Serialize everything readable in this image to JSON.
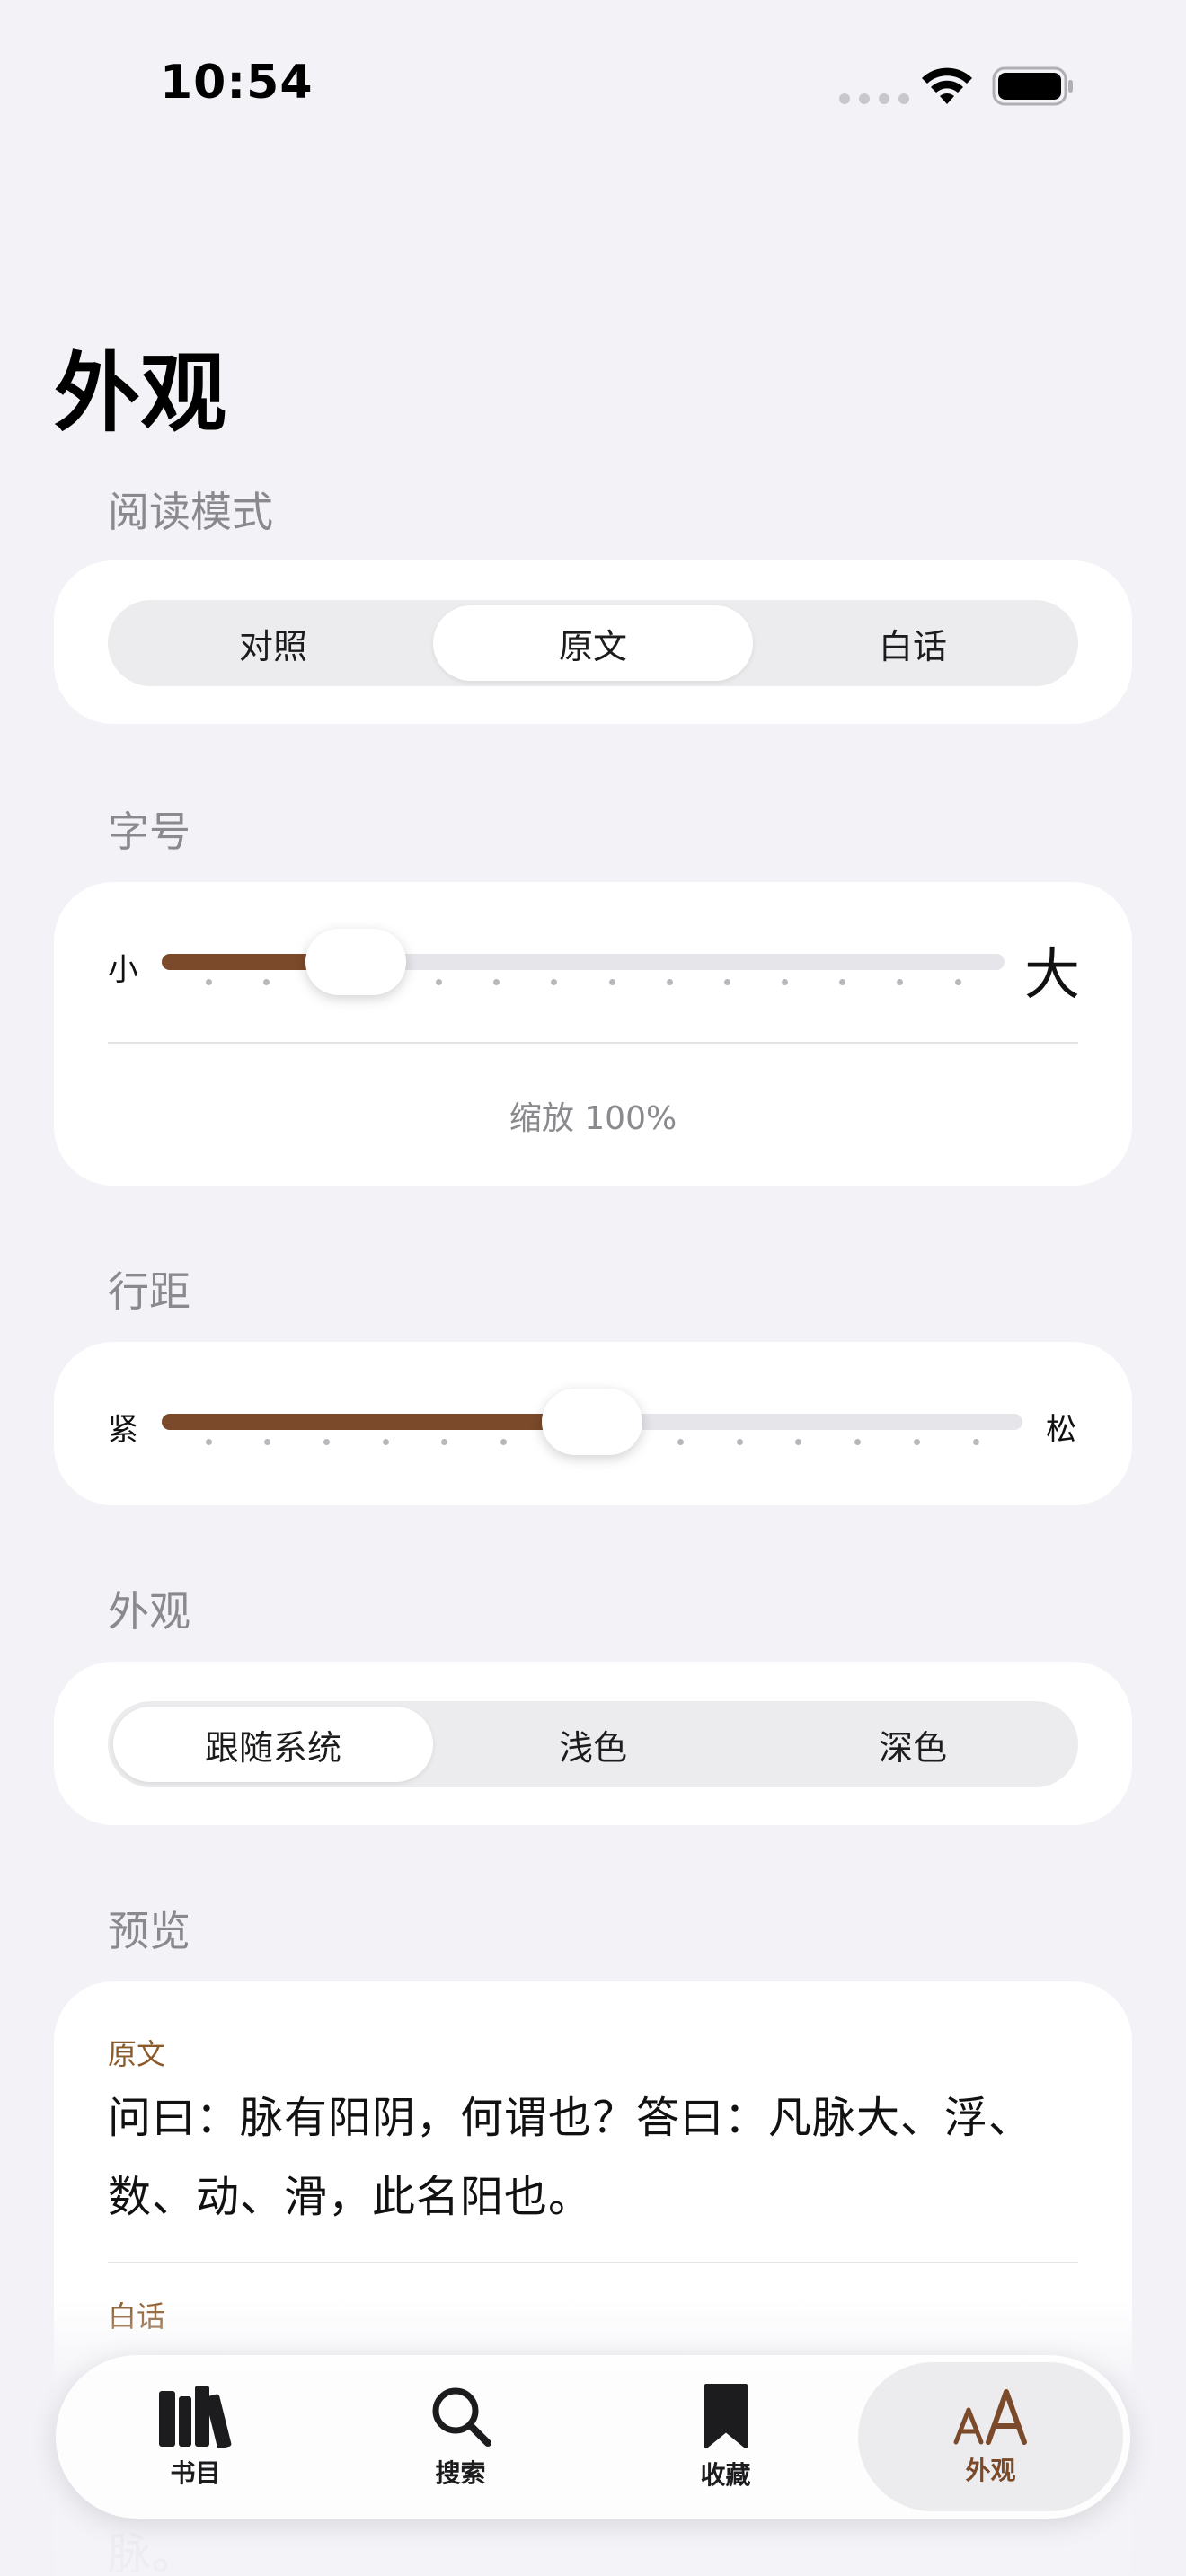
{
  "status": {
    "time": "10:54"
  },
  "page_title": "外观",
  "reading_mode": {
    "label": "阅读模式",
    "options": [
      "对照",
      "原文",
      "白话"
    ],
    "selected": "原文"
  },
  "font_size": {
    "label": "字号",
    "min_label": "小",
    "max_label": "大",
    "value": 0.23,
    "zoom_text": "缩放 100%"
  },
  "line_spacing": {
    "label": "行距",
    "min_label": "紧",
    "max_label": "松",
    "value": 0.5
  },
  "appearance": {
    "label": "外观",
    "options": [
      "跟随系统",
      "浅色",
      "深色"
    ],
    "selected": "跟随系统"
  },
  "preview": {
    "label": "预览",
    "original_tag": "原文",
    "original_text": "问曰：脉有阳阴，何谓也？答曰：凡脉大、浮、数、动、滑，此名阳也。",
    "vernacular_tag": "白话",
    "vernacular_text": "脉。"
  },
  "tabbar": {
    "items": [
      {
        "label": "书目",
        "icon": "books-icon"
      },
      {
        "label": "搜索",
        "icon": "magnifier-icon"
      },
      {
        "label": "收藏",
        "icon": "bookmark-icon"
      },
      {
        "label": "外观",
        "icon": "text-size-icon"
      }
    ],
    "active": "外观"
  },
  "colors": {
    "accent": "#7a4a2a",
    "background": "#f2f2f7",
    "card": "#ffffff"
  }
}
